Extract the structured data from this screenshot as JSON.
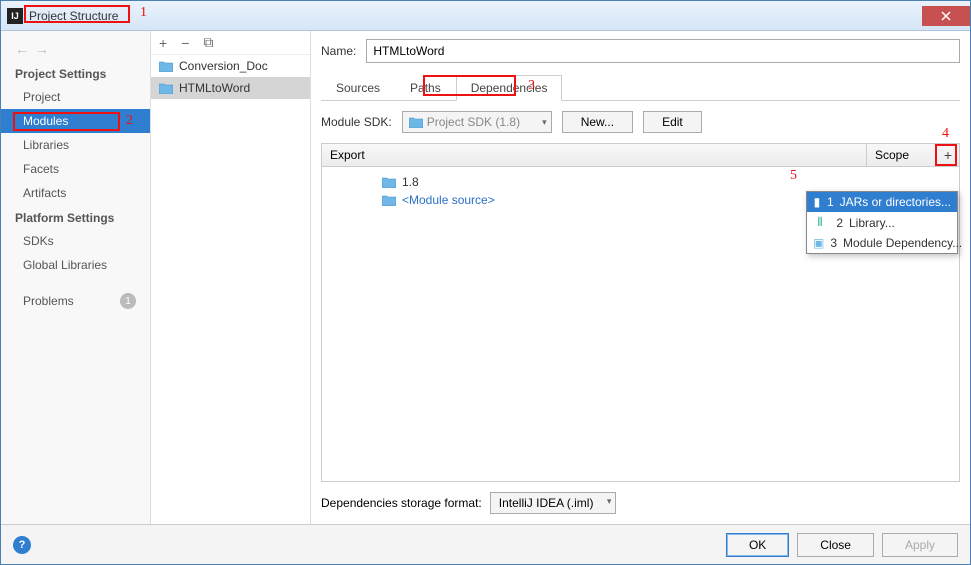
{
  "window": {
    "title": "Project Structure"
  },
  "sidebar": {
    "projectSettingsHeader": "Project Settings",
    "platformSettingsHeader": "Platform Settings",
    "items": {
      "project": "Project",
      "modules": "Modules",
      "libraries": "Libraries",
      "facets": "Facets",
      "artifacts": "Artifacts",
      "sdks": "SDKs",
      "globalLibs": "Global Libraries",
      "problems": "Problems"
    },
    "problemsCount": "1"
  },
  "modules": {
    "items": [
      "Conversion_Doc",
      "HTMLtoWord"
    ]
  },
  "main": {
    "nameLabel": "Name:",
    "nameValue": "HTMLtoWord",
    "tabs": {
      "sources": "Sources",
      "paths": "Paths",
      "dependencies": "Dependencies"
    },
    "sdkLabel": "Module SDK:",
    "sdkValue": "Project SDK (1.8)",
    "newBtn": "New...",
    "editBtn": "Edit",
    "colExport": "Export",
    "colScope": "Scope",
    "depRow1": "1.8",
    "depRow2": "<Module source>",
    "storageLabel": "Dependencies storage format:",
    "storageValue": "IntelliJ IDEA (.iml)"
  },
  "popup": {
    "item1": "JARs or directories...",
    "item2": "Library...",
    "item3": "Module Dependency..."
  },
  "footer": {
    "ok": "OK",
    "close": "Close",
    "apply": "Apply"
  },
  "annotations": {
    "a1": "1",
    "a2": "2",
    "a3": "3",
    "a4": "4",
    "a5": "5"
  }
}
